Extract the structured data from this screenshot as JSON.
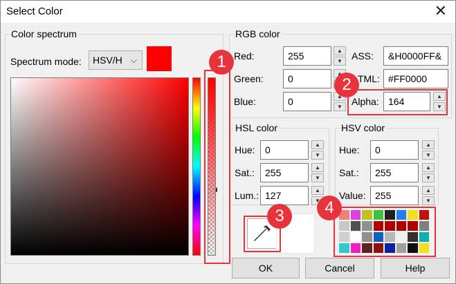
{
  "window": {
    "title": "Select Color",
    "close_glyph": "✕"
  },
  "spectrum_group": {
    "label": "Color spectrum",
    "mode_label": "Spectrum mode:",
    "mode_value": "HSV/H",
    "current_color": "#FF0000"
  },
  "rgb_group": {
    "label": "RGB color",
    "red_label": "Red:",
    "red_value": "255",
    "green_label": "Green:",
    "green_value": "0",
    "blue_label": "Blue:",
    "blue_value": "0",
    "ass_label": "ASS:",
    "ass_value": "&H0000FF&",
    "html_label": "TML:",
    "html_value": "#FF0000",
    "alpha_label": "Alpha:",
    "alpha_value": "164"
  },
  "hsl_group": {
    "label": "HSL color",
    "hue_label": "Hue:",
    "hue_value": "0",
    "sat_label": "Sat.:",
    "sat_value": "255",
    "lum_label": "Lum.:",
    "lum_value": "127"
  },
  "hsv_group": {
    "label": "HSV color",
    "hue_label": "Hue:",
    "hue_value": "0",
    "sat_label": "Sat.:",
    "sat_value": "255",
    "value_label": "Value:",
    "value_value": "255"
  },
  "buttons": {
    "ok": "OK",
    "cancel": "Cancel",
    "help": "Help"
  },
  "callouts": [
    "1",
    "2",
    "3",
    "4"
  ],
  "annotation_color": "#E8333C",
  "palette": [
    "#f08080",
    "#e040e0",
    "#c0c020",
    "#40c040",
    "#202020",
    "#2080f0",
    "#f0e020",
    "#c01010",
    "#c8c8c8",
    "#505050",
    "#909090",
    "#b00000",
    "#b00000",
    "#b00000",
    "#b00000",
    "#808080",
    "#d0d0d0",
    "#ffffff",
    "#909090",
    "#1060c0",
    "#b8b8b8",
    "#f0f0f0",
    "#303030",
    "#10b0b0",
    "#30c8d0",
    "#f020c0",
    "#602020",
    "#901010",
    "#1020a0",
    "#a0a0a0",
    "#101010",
    "#f0e020"
  ]
}
